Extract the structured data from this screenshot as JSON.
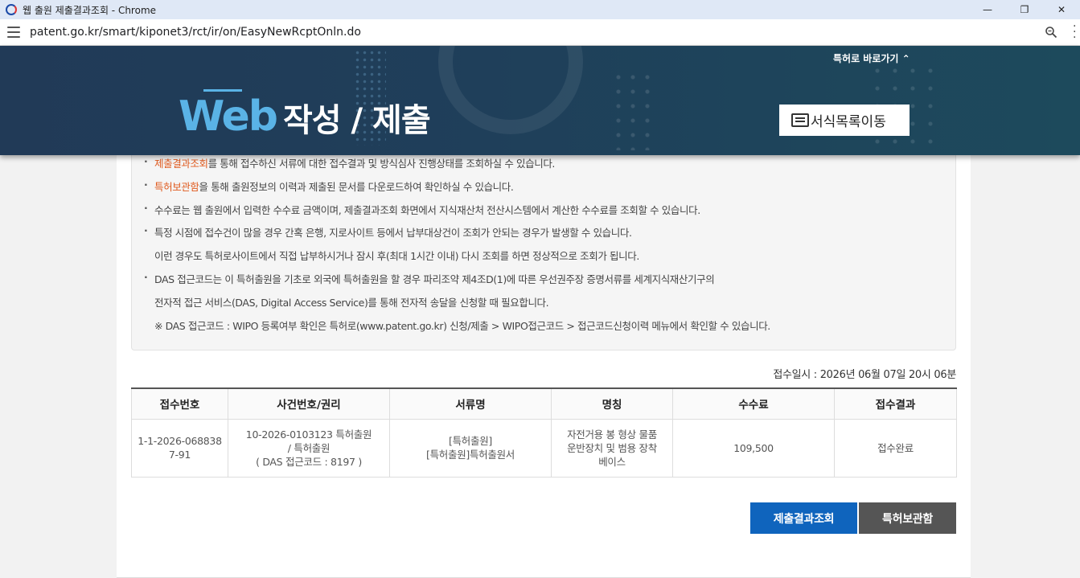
{
  "browser": {
    "window_title": "웹 출원 제출결과조회 - Chrome",
    "url": "patent.go.kr/smart/kiponet3/rct/ir/on/EasyNewRcptOnln.do",
    "window_buttons": [
      "—",
      "❐",
      "✕"
    ]
  },
  "banner": {
    "shortcut_label": "특허로 바로가기 ⌃",
    "web_text": "Web",
    "page_title": "작성 / 제출",
    "form_list_button": "서식목록이동",
    "colors": {
      "background": "#213a57",
      "accent": "#5ab3e6"
    }
  },
  "notice": {
    "lines": [
      {
        "highlight": "제출결과조회",
        "text": "를 통해 접수하신 서류에 대한 접수결과 및 방식심사 진행상태를 조회하실 수 있습니다."
      },
      {
        "highlight": "특허보관함",
        "text": "을 통해 출원정보의 이력과 제출된 문서를 다운로드하여 확인하실 수 있습니다."
      },
      {
        "text": "수수료는 웹 출원에서 입력한 수수료 금액이며, 제출결과조회 화면에서 지식재산처 전산시스템에서 계산한 수수료를 조회할 수 있습니다."
      },
      {
        "text": "특정 시점에 접수건이 많을 경우 간혹 은행, 지로사이트 등에서 납부대상건이 조회가 안되는 경우가 발생할 수 있습니다."
      },
      {
        "text": "이런 경우도 특허로사이트에서 직접 납부하시거나 잠시 후(최대 1시간 이내) 다시 조회를 하면 정상적으로 조회가 됩니다."
      },
      {
        "text": "DAS 접근코드는 이 특허출원을 기초로 외국에 특허출원을 할 경우 파리조약 제4조D(1)에 따른 우선권주장 증명서류를 세계지식재산기구의"
      },
      {
        "text": "전자적 접근 서비스(DAS, Digital Access Service)를 통해 전자적 송달을 신청할 때 필요합니다."
      },
      {
        "text": "※ DAS 접근코드 : WIPO 등록여부 확인은 특허로(www.patent.go.kr) 신청/제출 > WIPO접근코드 > 접근코드신청이력 메뉴에서 확인할 수 있습니다."
      }
    ],
    "highlight_color": "#e05a1e"
  },
  "receipt_time": "접수일시 : 2026년 06월 07일 20시 06분",
  "table": {
    "headers": [
      "접수번호",
      "사건번호/권리",
      "서류명",
      "명칭",
      "수수료",
      "접수결과"
    ],
    "row": {
      "receipt_no": "1-1-2026-068838 7-91",
      "case_line1": "10-2026-0103123 특허출원",
      "case_line2": "/ 특허출원",
      "case_line3": "( DAS 접근코드 : 8197 )",
      "doc_line1": "[특허출원]",
      "doc_line2": "[특허출원]특허출원서",
      "title_line1": "자전거용 봉 형상 물품",
      "title_line2": "운반장치 및 범용 장착",
      "title_line3": "베이스",
      "fee": "109,500",
      "result": "접수완료"
    }
  },
  "buttons": {
    "submit_result": "제출결과조회",
    "patent_storage": "특허보관함",
    "colors": {
      "primary": "#0f64bd",
      "secondary": "#555555"
    }
  }
}
